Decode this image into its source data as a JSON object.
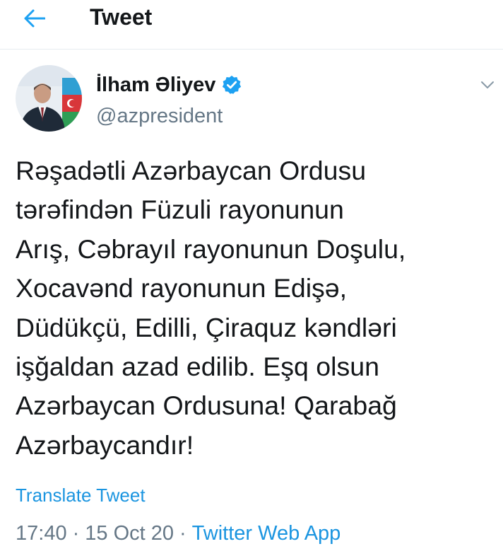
{
  "header": {
    "title": "Tweet",
    "back_icon": "arrow-left-icon"
  },
  "author": {
    "name": "İlham Əliyev",
    "handle": "@azpresident",
    "verified": true,
    "verified_icon": "verified-badge-icon",
    "avatar": "avatar",
    "menu_icon": "chevron-down-icon"
  },
  "tweet": {
    "text": "Rəşadətli Azərbaycan Ordusu\ntərəfindən Füzuli rayonunun\nArış, Cəbrayıl rayonunun Doşulu,\nXocavənd rayonunun Edişə,\nDüdükçü, Edilli, Çiraquz kəndləri\nişğaldan azad edilib. Eşq olsun\nAzərbaycan Ordusuna! Qarabağ\nAzərbaycandır!",
    "translate_label": "Translate Tweet",
    "time": "17:40",
    "date": "15 Oct 20",
    "separator": "·",
    "source": "Twitter Web App"
  },
  "colors": {
    "accent": "#1da1f2",
    "link": "#1b95e0",
    "text": "#14171a",
    "secondary": "#657786",
    "divider": "#e6ecf0"
  }
}
